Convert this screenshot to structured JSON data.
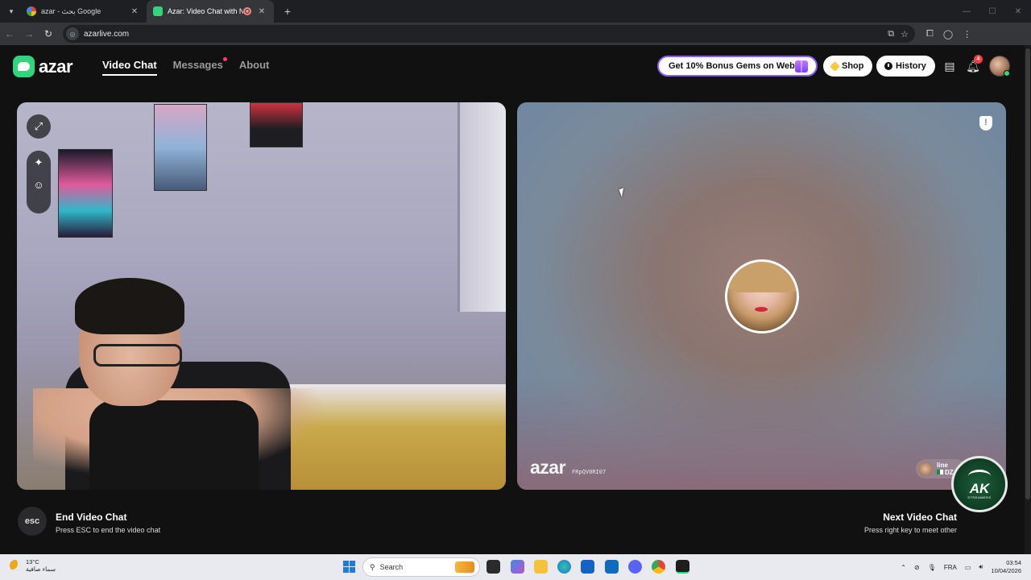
{
  "browser": {
    "tabs": [
      {
        "title": "azar - بحث Google",
        "active": false
      },
      {
        "title": "Azar: Video Chat with New",
        "active": true
      }
    ],
    "url": "azarlive.com"
  },
  "header": {
    "logo": "azar",
    "nav": [
      {
        "label": "Video Chat",
        "active": true
      },
      {
        "label": "Messages",
        "active": false
      },
      {
        "label": "About",
        "active": false
      }
    ],
    "promo": "Get 10% Bonus Gems on Web!",
    "shop": "Shop",
    "history": "History",
    "notification_count": "4"
  },
  "partner": {
    "watermark": "azar",
    "watermark_id": "FRpQV0RI07",
    "name": "line",
    "country": "DZ"
  },
  "hints": {
    "esc_key": "esc",
    "end_title": "End Video Chat",
    "end_sub": "Press ESC to end the video chat",
    "next_title": "Next Video Chat",
    "next_sub": "Press right key to meet other"
  },
  "overlay_badge": {
    "text": "AK",
    "sub": "STREAMERS"
  },
  "taskbar": {
    "temperature": "13°C",
    "weather": "سماء صافية",
    "search": "Search",
    "language": "FRA",
    "time": "03:54",
    "date": "10/04/2026"
  },
  "colors": {
    "brand": "#2fd67b",
    "promo_border": "#8c5cff",
    "notification": "#ff3b3b"
  }
}
